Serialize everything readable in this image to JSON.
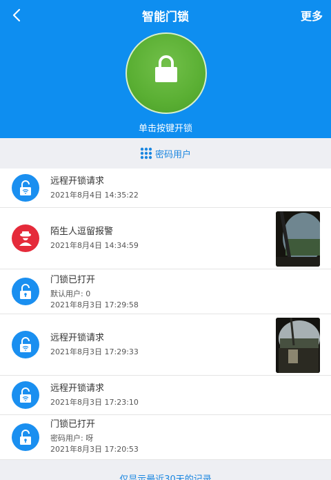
{
  "header": {
    "title": "智能门锁",
    "more_label": "更多",
    "lock_button_label": "单击按键开锁"
  },
  "password_users": {
    "label": "密码用户"
  },
  "records": [
    {
      "title": "远程开锁请求",
      "time": "2021年8月4日 14:35:22",
      "icon": "unlock-wifi-icon",
      "has_thumbnail": false
    },
    {
      "title": "陌生人逗留报警",
      "time": "2021年8月4日 14:34:59",
      "icon": "stranger-icon",
      "has_thumbnail": true
    },
    {
      "title": "门锁已打开",
      "user": "默认用户: 0",
      "time": "2021年8月3日 17:29:58",
      "icon": "unlock-icon",
      "has_thumbnail": false
    },
    {
      "title": "远程开锁请求",
      "time": "2021年8月3日 17:29:33",
      "icon": "unlock-wifi-icon",
      "has_thumbnail": true
    },
    {
      "title": "远程开锁请求",
      "time": "2021年8月3日 17:23:10",
      "icon": "unlock-wifi-icon",
      "has_thumbnail": false
    },
    {
      "title": "门锁已打开",
      "user": "密码用户: 呀",
      "time": "2021年8月3日 17:20:53",
      "icon": "unlock-icon",
      "has_thumbnail": false
    }
  ],
  "footer": {
    "note": "仅显示最近30天的记录"
  },
  "colors": {
    "header_blue": "#0e8ef0",
    "lock_green": "#5aaf33",
    "icon_blue": "#1a8ff0",
    "alert_red": "#e52a3a",
    "link_blue": "#1a86e0"
  }
}
